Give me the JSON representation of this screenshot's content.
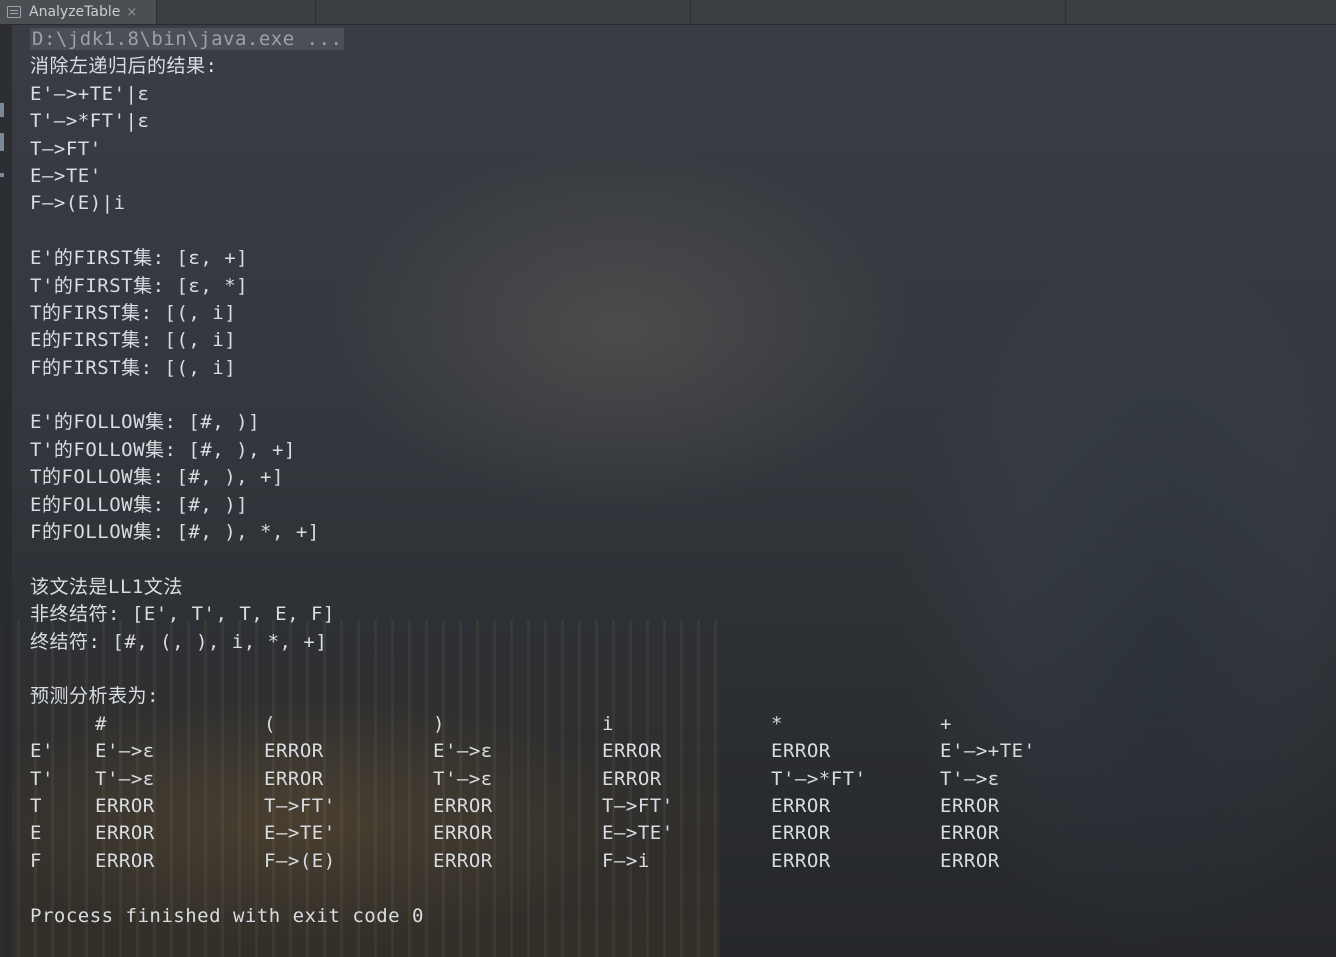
{
  "tab": {
    "title": "AnalyzeTable",
    "close": "×"
  },
  "console": {
    "command": "D:\\jdk1.8\\bin\\java.exe ...",
    "elim_title": "消除左递归后的结果:",
    "productions": [
      "E'—>+TE'|ε",
      "T'—>*FT'|ε",
      "T—>FT'",
      "E—>TE'",
      "F—>(E)|i"
    ],
    "first_sets": [
      "E'的FIRST集: [ε, +]",
      "T'的FIRST集: [ε, *]",
      "T的FIRST集: [(, i]",
      "E的FIRST集: [(, i]",
      "F的FIRST集: [(, i]"
    ],
    "follow_sets": [
      "E'的FOLLOW集: [#, )]",
      "T'的FOLLOW集: [#, ), +]",
      "T的FOLLOW集: [#, ), +]",
      "E的FOLLOW集: [#, )]",
      "F的FOLLOW集: [#, ), *, +]"
    ],
    "ll1_line": "该文法是LL1文法",
    "nonterminals": "非终结符: [E', T', T, E, F]",
    "terminals": "终结符: [#, (, ), i, *, +]",
    "table_title": "预测分析表为:",
    "table": {
      "headers": [
        "",
        "#",
        "(",
        ")",
        "i",
        "*",
        "+"
      ],
      "rows": [
        [
          "E'",
          "E'—>ε",
          "ERROR",
          "E'—>ε",
          "ERROR",
          "ERROR",
          "E'—>+TE'"
        ],
        [
          "T'",
          "T'—>ε",
          "ERROR",
          "T'—>ε",
          "ERROR",
          "T'—>*FT'",
          "T'—>ε"
        ],
        [
          "T",
          "ERROR",
          "T—>FT'",
          "ERROR",
          "T—>FT'",
          "ERROR",
          "ERROR"
        ],
        [
          "E",
          "ERROR",
          "E—>TE'",
          "ERROR",
          "E—>TE'",
          "ERROR",
          "ERROR"
        ],
        [
          "F",
          "ERROR",
          "F—>(E)",
          "ERROR",
          "F—>i",
          "ERROR",
          "ERROR"
        ]
      ]
    },
    "exit_line": "Process finished with exit code 0"
  }
}
